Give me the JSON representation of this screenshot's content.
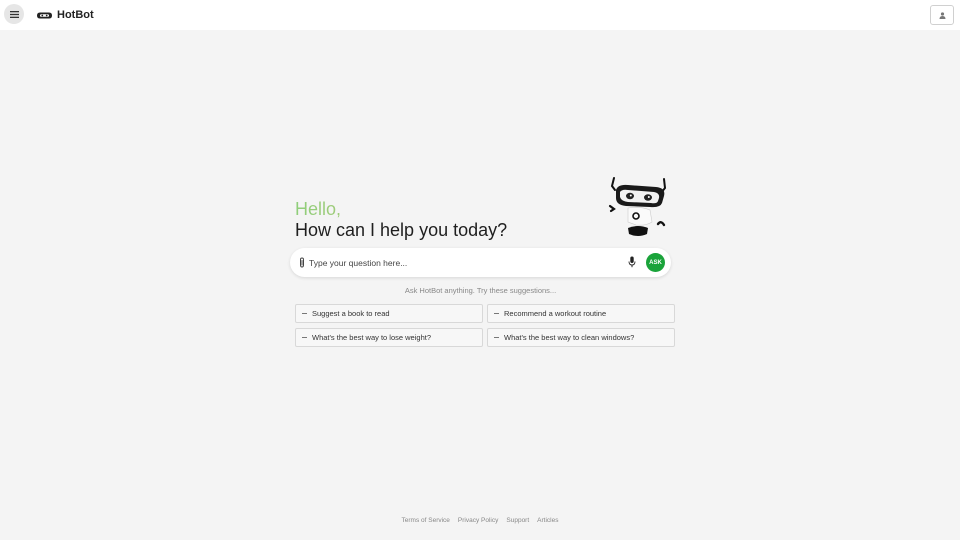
{
  "header": {
    "brand_name": "HotBot",
    "menu_icon": "hamburger-icon",
    "account_icon": "user-icon"
  },
  "hero": {
    "hello": "Hello,",
    "prompt": "How can I help you today?"
  },
  "search": {
    "placeholder": "Type your question here...",
    "value": "",
    "ask_label": "ASK",
    "ask_color": "#1aa33a"
  },
  "hint": "Ask HotBot anything. Try these suggestions...",
  "suggestions": [
    "Suggest a book to read",
    "Recommend a workout routine",
    "What's the best way to lose weight?",
    "What's the best way to clean windows?"
  ],
  "footer": {
    "links": [
      "Terms of Service",
      "Privacy Policy",
      "Support",
      "Articles"
    ]
  }
}
